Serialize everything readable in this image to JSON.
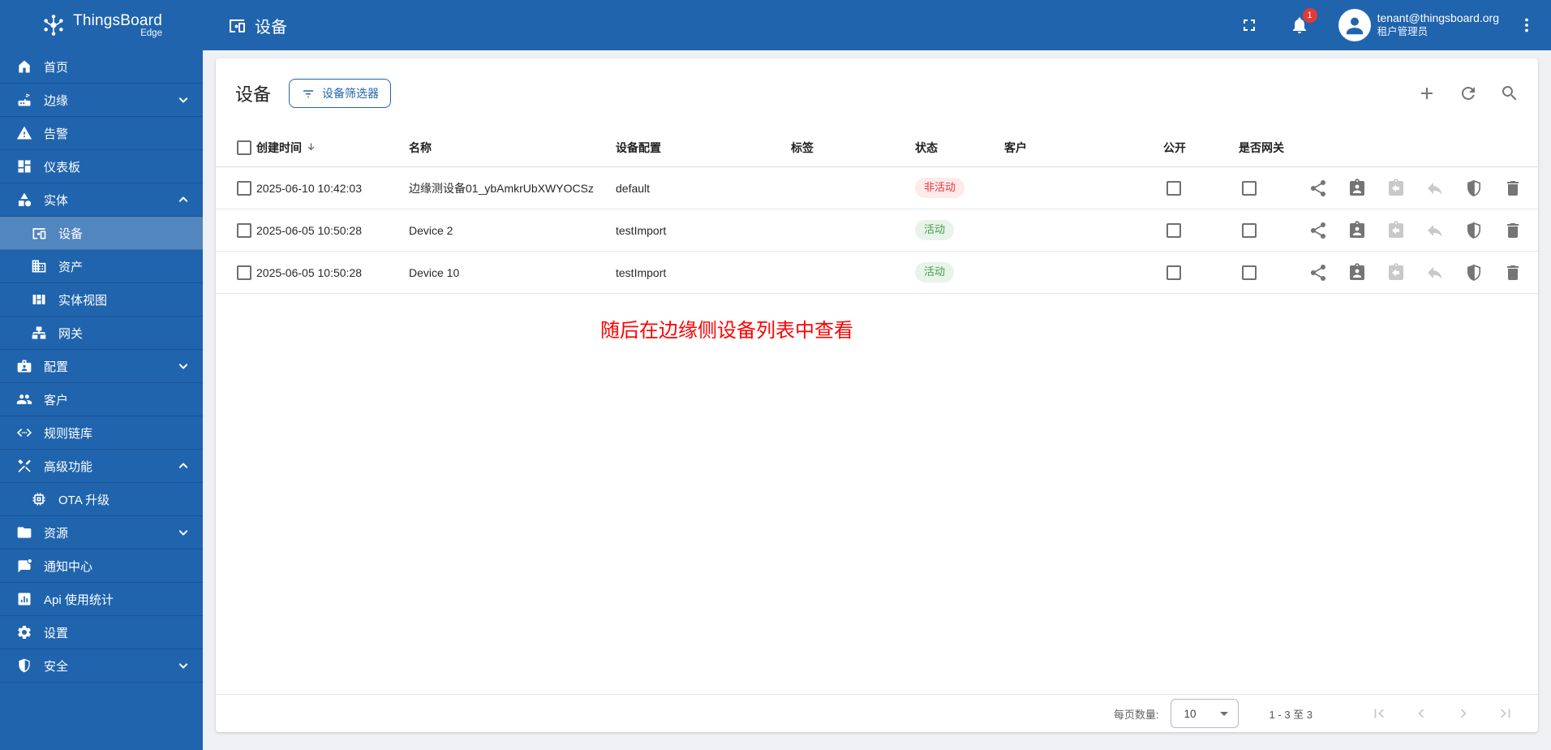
{
  "colors": {
    "primary": "#2064ae",
    "badge_red": "#e53935",
    "status_active_text": "#42a048",
    "status_active_bg": "#e8f3e9",
    "status_inactive_text": "#e53935",
    "status_inactive_bg": "#fdeaea",
    "annotation_red": "#ff0000"
  },
  "topbar": {
    "brand": "ThingsBoard",
    "brand_sub": "Edge",
    "page_title": "设备",
    "notification_count": "1",
    "user_email": "tenant@thingsboard.org",
    "user_role": "租户管理员"
  },
  "sidebar": {
    "items": [
      {
        "label": "首页"
      },
      {
        "label": "边缘"
      },
      {
        "label": "告警"
      },
      {
        "label": "仪表板"
      },
      {
        "label": "实体"
      },
      {
        "label": "设备"
      },
      {
        "label": "资产"
      },
      {
        "label": "实体视图"
      },
      {
        "label": "网关"
      },
      {
        "label": "配置"
      },
      {
        "label": "客户"
      },
      {
        "label": "规则链库"
      },
      {
        "label": "高级功能"
      },
      {
        "label": "OTA 升级"
      },
      {
        "label": "资源"
      },
      {
        "label": "通知中心"
      },
      {
        "label": "Api 使用统计"
      },
      {
        "label": "设置"
      },
      {
        "label": "安全"
      }
    ]
  },
  "card": {
    "title": "设备",
    "filter_button_label": "设备筛选器",
    "table": {
      "columns": {
        "created_time": "创建时间",
        "name": "名称",
        "device_profile": "设备配置",
        "label": "标签",
        "state": "状态",
        "customer": "客户",
        "public": "公开",
        "is_gateway": "是否网关"
      },
      "rows": [
        {
          "created_time": "2025-06-10 10:42:03",
          "name": "边缘测设备01_ybAmkrUbXWYOCSz",
          "device_profile": "default",
          "label": "",
          "state": "非活动",
          "customer": ""
        },
        {
          "created_time": "2025-06-05 10:50:28",
          "name": "Device 2",
          "device_profile": "testImport",
          "label": "",
          "state": "活动",
          "customer": ""
        },
        {
          "created_time": "2025-06-05 10:50:28",
          "name": "Device 10",
          "device_profile": "testImport",
          "label": "",
          "state": "活动",
          "customer": ""
        }
      ]
    },
    "annotation": "随后在边缘侧设备列表中查看",
    "pagination": {
      "per_page_label": "每页数量:",
      "per_page_value": "10",
      "range": "1 - 3 至 3"
    }
  }
}
